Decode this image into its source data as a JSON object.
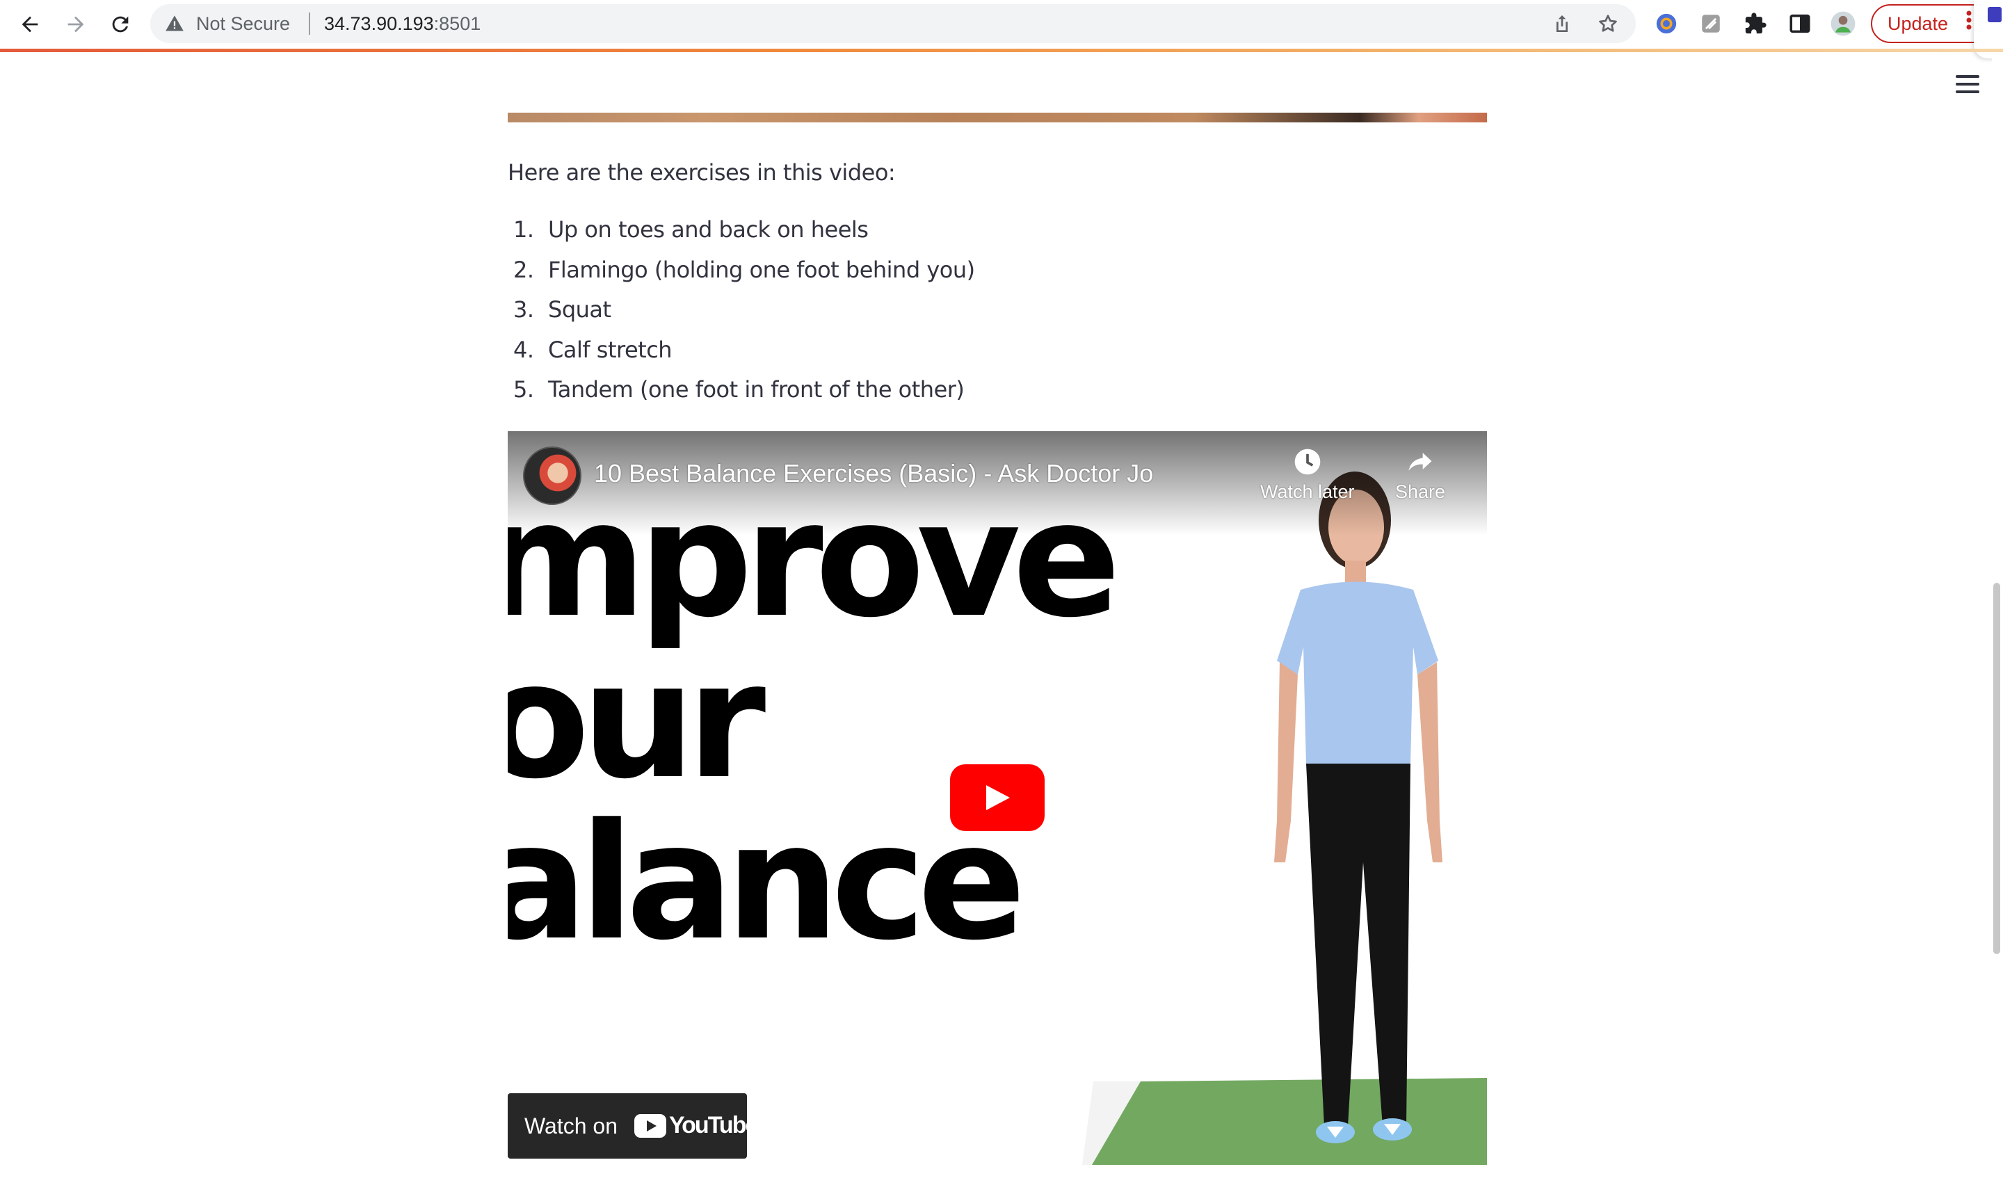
{
  "browser": {
    "security_label": "Not Secure",
    "url_host": "34.73.90.193",
    "url_port": ":8501",
    "update_label": "Update"
  },
  "content": {
    "intro": "Here are the exercises in this video:",
    "exercises": [
      {
        "num": "1.",
        "text": "Up on toes and back on heels"
      },
      {
        "num": "2.",
        "text": "Flamingo (holding one foot behind you)"
      },
      {
        "num": "3.",
        "text": "Squat"
      },
      {
        "num": "4.",
        "text": "Calf stretch"
      },
      {
        "num": "5.",
        "text": "Tandem (one foot in front of the other)"
      }
    ]
  },
  "video": {
    "title": "10 Best Balance Exercises (Basic) - Ask Doctor Jo",
    "watch_later_label": "Watch later",
    "share_label": "Share",
    "thumbnail_lines": [
      "mprove",
      "our",
      "alance"
    ],
    "watch_on_label": "Watch on",
    "youtube_wordmark": "YouTube",
    "play_color": "#ff0000"
  },
  "colors": {
    "accent_update": "#c5221f",
    "text": "#31333f"
  }
}
